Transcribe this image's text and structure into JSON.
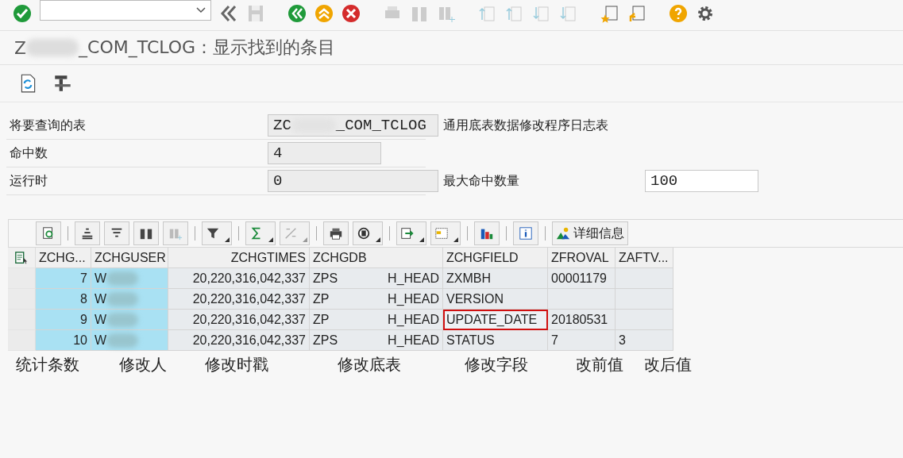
{
  "title": {
    "prefix": "Z",
    "suffix": "_COM_TCLOG：显示找到的条目"
  },
  "form": [
    {
      "label": "将要查询的表",
      "value_prefix": "ZC",
      "value_suffix": "_COM_TCLOG",
      "description": "通用底表数据修改程序日志表"
    },
    {
      "label": "命中数",
      "value": "4"
    },
    {
      "label": "运行时",
      "value": "0",
      "extra_label": "最大命中数量",
      "extra_value": "100"
    }
  ],
  "alv_toolbar": {
    "details_button": "详细信息"
  },
  "table": {
    "columns": [
      "ZCHG...",
      "ZCHGUSER",
      "ZCHGTIMES",
      "ZCHGDB",
      "ZCHGFIELD",
      "ZFROVAL",
      "ZAFTV..."
    ],
    "rows": [
      {
        "id": "7",
        "user": "W",
        "time": "20,220,316,042,337",
        "db_prefix": "ZPS",
        "db_suffix": "H_HEAD",
        "field": "ZXMBH",
        "field_focused": false,
        "from": "00001179"
      },
      {
        "id": "8",
        "user": "W",
        "time": "20,220,316,042,337",
        "db_prefix": "ZP",
        "db_suffix": "H_HEAD",
        "field": "VERSION",
        "field_focused": false
      },
      {
        "id": "9",
        "user": "W",
        "time": "20,220,316,042,337",
        "db_prefix": "ZP",
        "db_suffix": "H_HEAD",
        "field": "UPDATE_DATE",
        "field_focused": true,
        "from": "20180531"
      },
      {
        "id": "10",
        "user": "W",
        "time": "20,220,316,042,337",
        "db_prefix": "ZPS",
        "db_suffix": "H_HEAD",
        "field": "STATUS",
        "field_focused": false,
        "from": "7",
        "to": "3"
      }
    ]
  },
  "annotations": [
    "统计条数",
    "修改人",
    "修改时戳",
    "修改底表",
    "修改字段",
    "改前值",
    "改后值"
  ]
}
